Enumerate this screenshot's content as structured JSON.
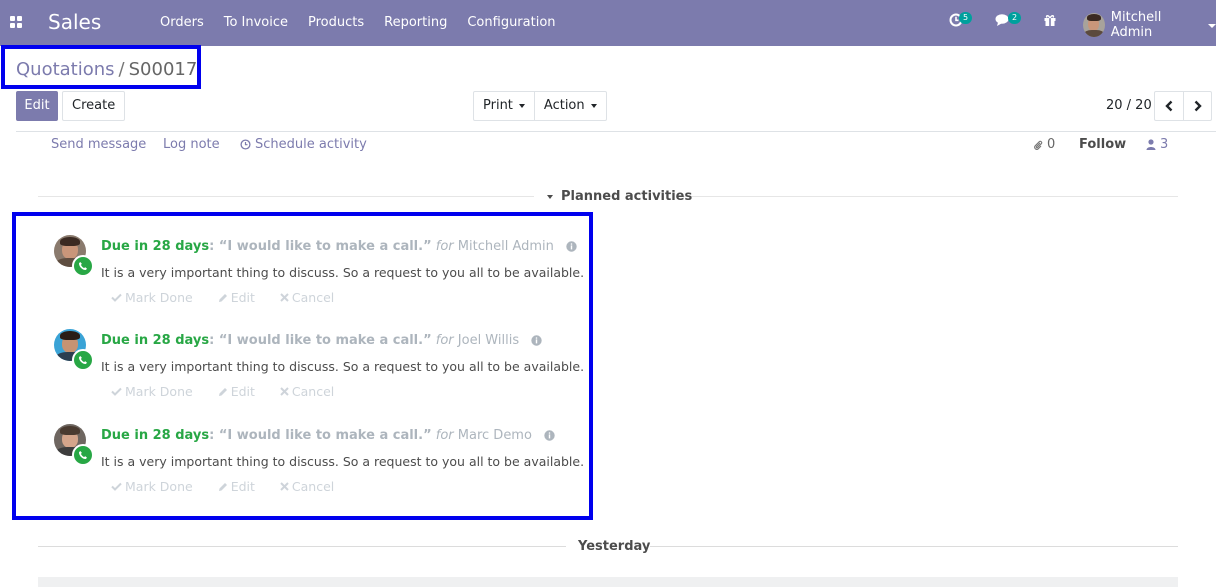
{
  "navbar": {
    "brand": "Sales",
    "menu": [
      "Orders",
      "To Invoice",
      "Products",
      "Reporting",
      "Configuration"
    ],
    "activity_count": "5",
    "message_count": "2",
    "user_name": "Mitchell Admin",
    "color": "#7c7bad"
  },
  "breadcrumb": {
    "parent": "Quotations",
    "separator": "/",
    "current": "S00017"
  },
  "buttons": {
    "edit": "Edit",
    "create": "Create",
    "print": "Print",
    "action": "Action"
  },
  "pager": {
    "value": "20 / 20"
  },
  "chatter": {
    "send_message": "Send message",
    "log_note": "Log note",
    "schedule_activity": "Schedule activity",
    "attachments_count": "0",
    "follow": "Follow",
    "followers_count": "3"
  },
  "planned_activities_label": "Planned activities",
  "activities": [
    {
      "due": "Due in 28 days",
      "summary": "“I would like to make a call.”",
      "for_label": "for",
      "assignee": "Mitchell Admin",
      "note": "It is a very important thing to discuss. So a request to you all to be available.",
      "actions": {
        "mark_done": "Mark Done",
        "edit": "Edit",
        "cancel": "Cancel"
      }
    },
    {
      "due": "Due in 28 days",
      "summary": "“I would like to make a call.”",
      "for_label": "for",
      "assignee": "Joel Willis",
      "note": "It is a very important thing to discuss. So a request to you all to be available.",
      "actions": {
        "mark_done": "Mark Done",
        "edit": "Edit",
        "cancel": "Cancel"
      }
    },
    {
      "due": "Due in 28 days",
      "summary": "“I would like to make a call.”",
      "for_label": "for",
      "assignee": "Marc Demo",
      "note": "It is a very important thing to discuss. So a request to you all to be available.",
      "actions": {
        "mark_done": "Mark Done",
        "edit": "Edit",
        "cancel": "Cancel"
      }
    }
  ],
  "yesterday_label": "Yesterday",
  "colors": {
    "accent": "#7c7bad",
    "success": "#28a745",
    "highlight_frame": "#0000ee",
    "badge": "#00a09d"
  }
}
